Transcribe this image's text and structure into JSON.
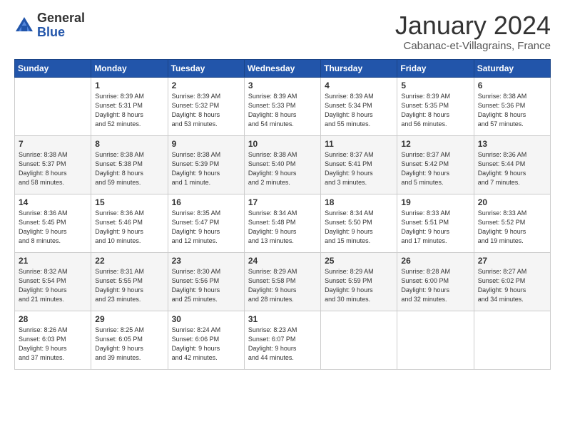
{
  "header": {
    "logo_general": "General",
    "logo_blue": "Blue",
    "title": "January 2024",
    "location": "Cabanac-et-Villagrains, France"
  },
  "weekdays": [
    "Sunday",
    "Monday",
    "Tuesday",
    "Wednesday",
    "Thursday",
    "Friday",
    "Saturday"
  ],
  "weeks": [
    [
      {
        "day": "",
        "info": ""
      },
      {
        "day": "1",
        "info": "Sunrise: 8:39 AM\nSunset: 5:31 PM\nDaylight: 8 hours\nand 52 minutes."
      },
      {
        "day": "2",
        "info": "Sunrise: 8:39 AM\nSunset: 5:32 PM\nDaylight: 8 hours\nand 53 minutes."
      },
      {
        "day": "3",
        "info": "Sunrise: 8:39 AM\nSunset: 5:33 PM\nDaylight: 8 hours\nand 54 minutes."
      },
      {
        "day": "4",
        "info": "Sunrise: 8:39 AM\nSunset: 5:34 PM\nDaylight: 8 hours\nand 55 minutes."
      },
      {
        "day": "5",
        "info": "Sunrise: 8:39 AM\nSunset: 5:35 PM\nDaylight: 8 hours\nand 56 minutes."
      },
      {
        "day": "6",
        "info": "Sunrise: 8:38 AM\nSunset: 5:36 PM\nDaylight: 8 hours\nand 57 minutes."
      }
    ],
    [
      {
        "day": "7",
        "info": "Sunrise: 8:38 AM\nSunset: 5:37 PM\nDaylight: 8 hours\nand 58 minutes."
      },
      {
        "day": "8",
        "info": "Sunrise: 8:38 AM\nSunset: 5:38 PM\nDaylight: 8 hours\nand 59 minutes."
      },
      {
        "day": "9",
        "info": "Sunrise: 8:38 AM\nSunset: 5:39 PM\nDaylight: 9 hours\nand 1 minute."
      },
      {
        "day": "10",
        "info": "Sunrise: 8:38 AM\nSunset: 5:40 PM\nDaylight: 9 hours\nand 2 minutes."
      },
      {
        "day": "11",
        "info": "Sunrise: 8:37 AM\nSunset: 5:41 PM\nDaylight: 9 hours\nand 3 minutes."
      },
      {
        "day": "12",
        "info": "Sunrise: 8:37 AM\nSunset: 5:42 PM\nDaylight: 9 hours\nand 5 minutes."
      },
      {
        "day": "13",
        "info": "Sunrise: 8:36 AM\nSunset: 5:44 PM\nDaylight: 9 hours\nand 7 minutes."
      }
    ],
    [
      {
        "day": "14",
        "info": "Sunrise: 8:36 AM\nSunset: 5:45 PM\nDaylight: 9 hours\nand 8 minutes."
      },
      {
        "day": "15",
        "info": "Sunrise: 8:36 AM\nSunset: 5:46 PM\nDaylight: 9 hours\nand 10 minutes."
      },
      {
        "day": "16",
        "info": "Sunrise: 8:35 AM\nSunset: 5:47 PM\nDaylight: 9 hours\nand 12 minutes."
      },
      {
        "day": "17",
        "info": "Sunrise: 8:34 AM\nSunset: 5:48 PM\nDaylight: 9 hours\nand 13 minutes."
      },
      {
        "day": "18",
        "info": "Sunrise: 8:34 AM\nSunset: 5:50 PM\nDaylight: 9 hours\nand 15 minutes."
      },
      {
        "day": "19",
        "info": "Sunrise: 8:33 AM\nSunset: 5:51 PM\nDaylight: 9 hours\nand 17 minutes."
      },
      {
        "day": "20",
        "info": "Sunrise: 8:33 AM\nSunset: 5:52 PM\nDaylight: 9 hours\nand 19 minutes."
      }
    ],
    [
      {
        "day": "21",
        "info": "Sunrise: 8:32 AM\nSunset: 5:54 PM\nDaylight: 9 hours\nand 21 minutes."
      },
      {
        "day": "22",
        "info": "Sunrise: 8:31 AM\nSunset: 5:55 PM\nDaylight: 9 hours\nand 23 minutes."
      },
      {
        "day": "23",
        "info": "Sunrise: 8:30 AM\nSunset: 5:56 PM\nDaylight: 9 hours\nand 25 minutes."
      },
      {
        "day": "24",
        "info": "Sunrise: 8:29 AM\nSunset: 5:58 PM\nDaylight: 9 hours\nand 28 minutes."
      },
      {
        "day": "25",
        "info": "Sunrise: 8:29 AM\nSunset: 5:59 PM\nDaylight: 9 hours\nand 30 minutes."
      },
      {
        "day": "26",
        "info": "Sunrise: 8:28 AM\nSunset: 6:00 PM\nDaylight: 9 hours\nand 32 minutes."
      },
      {
        "day": "27",
        "info": "Sunrise: 8:27 AM\nSunset: 6:02 PM\nDaylight: 9 hours\nand 34 minutes."
      }
    ],
    [
      {
        "day": "28",
        "info": "Sunrise: 8:26 AM\nSunset: 6:03 PM\nDaylight: 9 hours\nand 37 minutes."
      },
      {
        "day": "29",
        "info": "Sunrise: 8:25 AM\nSunset: 6:05 PM\nDaylight: 9 hours\nand 39 minutes."
      },
      {
        "day": "30",
        "info": "Sunrise: 8:24 AM\nSunset: 6:06 PM\nDaylight: 9 hours\nand 42 minutes."
      },
      {
        "day": "31",
        "info": "Sunrise: 8:23 AM\nSunset: 6:07 PM\nDaylight: 9 hours\nand 44 minutes."
      },
      {
        "day": "",
        "info": ""
      },
      {
        "day": "",
        "info": ""
      },
      {
        "day": "",
        "info": ""
      }
    ]
  ]
}
